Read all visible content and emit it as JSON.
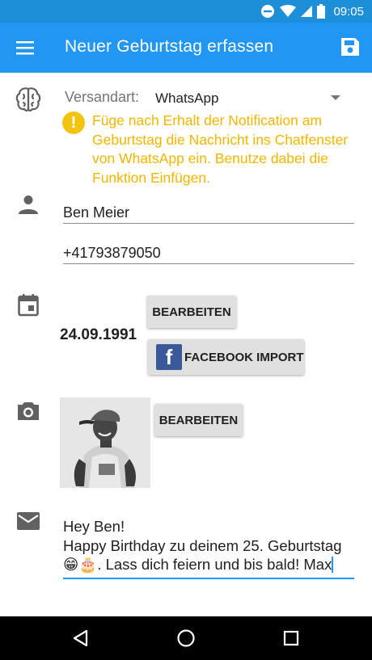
{
  "status_bar": {
    "time": "09:05",
    "icons": [
      "do-not-disturb-icon",
      "wifi-icon",
      "signal-icon",
      "battery-icon"
    ]
  },
  "app_bar": {
    "title": "Neuer Geburtstag erfassen",
    "menu_icon": "menu-icon",
    "save_icon": "save-icon",
    "color": "#2196f3"
  },
  "versand": {
    "label": "Versandart:",
    "value": "WhatsApp",
    "icon": "brain-icon"
  },
  "warning": {
    "icon_glyph": "!",
    "text": "Füge nach Erhalt der Notification am Geburtstag die Nachricht ins Chatfenster von WhatsApp ein. Benutze dabei die Funktion Einfügen.",
    "color": "#f2b600"
  },
  "contact": {
    "icon": "person-icon",
    "name": "Ben Meier",
    "phone": "+41793879050"
  },
  "birthday": {
    "icon": "calendar-icon",
    "date": "24.09.1991",
    "edit_label": "BEARBEITEN",
    "facebook_label": "FACEBOOK IMPORT",
    "facebook_logo": "f"
  },
  "photo": {
    "icon": "camera-icon",
    "edit_label": "BEARBEITEN"
  },
  "message": {
    "icon": "mail-icon",
    "text": "Hey Ben!\nHappy Birthday zu deinem 25. Geburtstag 😁🎂. Lass dich feiern und bis bald! Max"
  },
  "nav_bar": {
    "icons": [
      "back-icon",
      "home-icon",
      "recents-icon"
    ]
  }
}
